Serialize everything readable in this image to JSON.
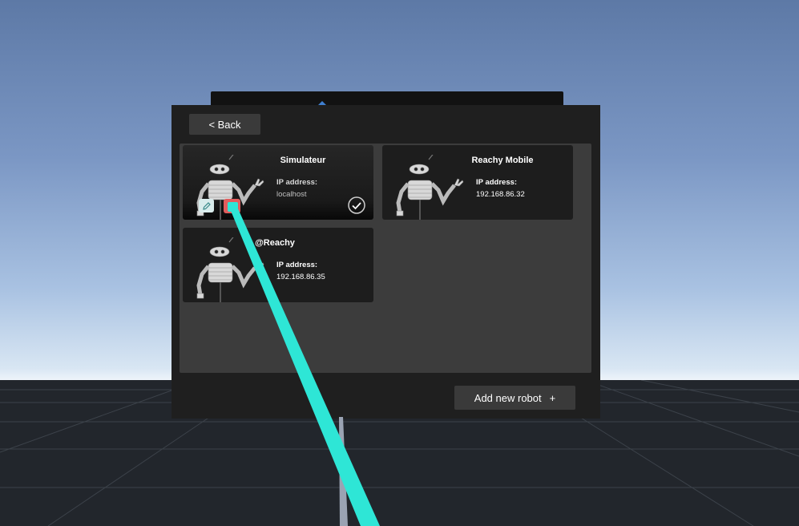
{
  "navigation": {
    "back_label": "< Back"
  },
  "robots": [
    {
      "name": "Simulateur",
      "ip_label": "IP address:",
      "ip": "localhost",
      "selected": true,
      "actions": [
        "edit-icon",
        "delete-icon"
      ]
    },
    {
      "name": "Reachy Mobile",
      "ip_label": "IP address:",
      "ip": "192.168.86.32",
      "selected": false
    },
    {
      "name": "@Reachy",
      "ip_label": "IP address:",
      "ip": "192.168.86.35",
      "selected": false
    }
  ],
  "footer": {
    "add_label": "Add new robot",
    "add_icon": "+"
  },
  "colors": {
    "laser": "#2ee6d6",
    "delete": "#e25d5d",
    "edit": "#d9ecec",
    "panel": "#1f1f1f",
    "list": "#3c3c3c",
    "button": "#3a3a3a"
  }
}
